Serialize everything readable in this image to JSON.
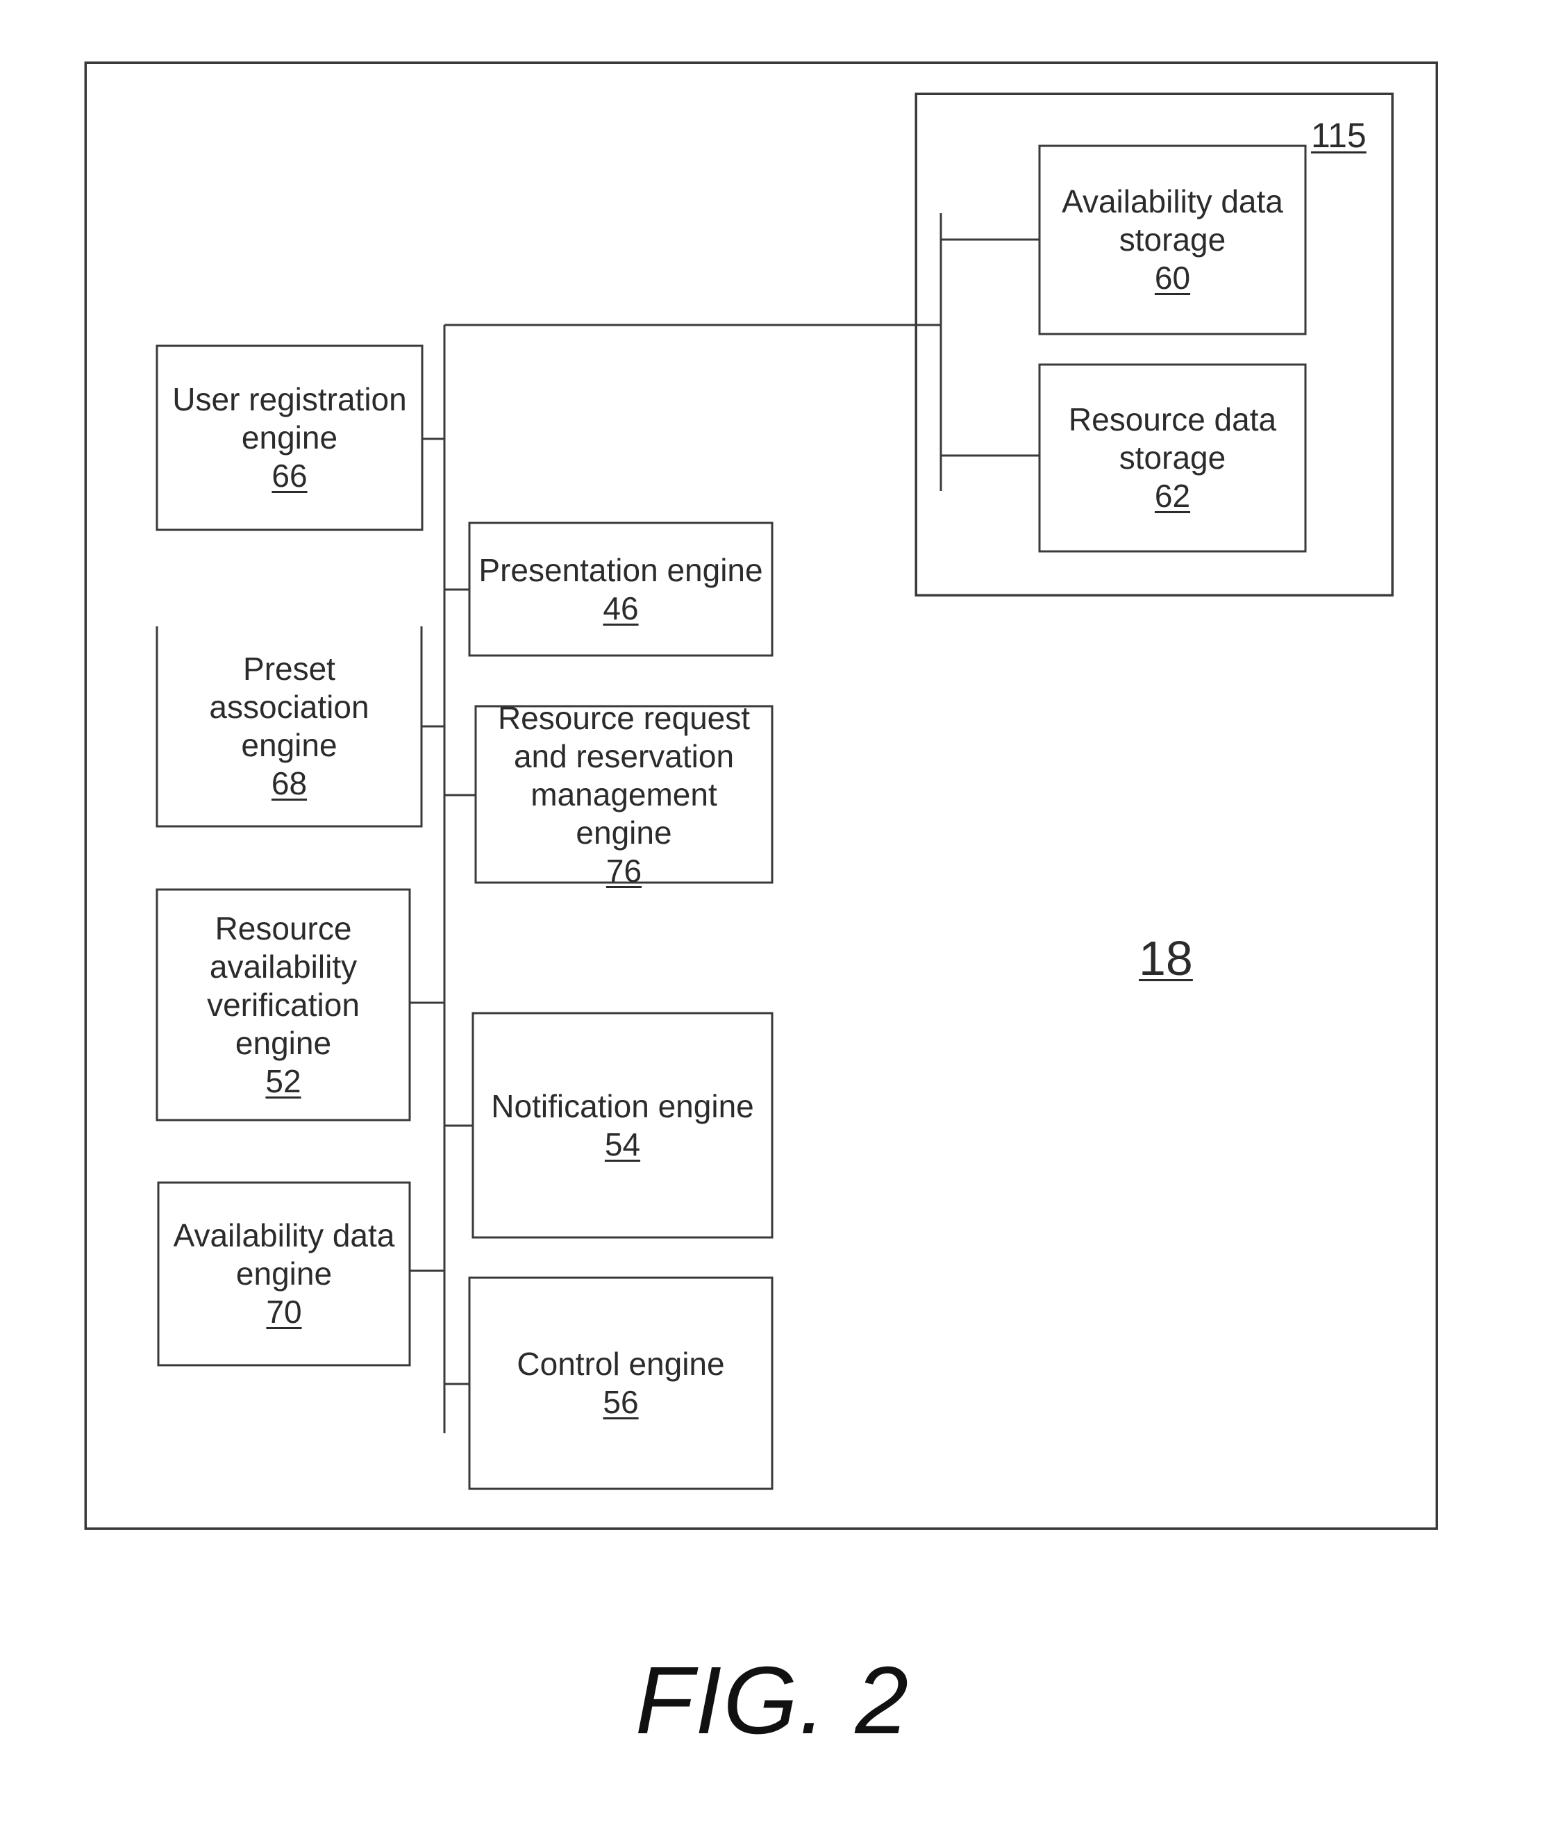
{
  "figure": {
    "caption": "FIG. 2",
    "system_ref": "18",
    "storage_group_ref": "115"
  },
  "engines_left": [
    {
      "name": "User registration\nengine",
      "ref": "66"
    },
    {
      "name": "Preset\nassociation\nengine",
      "ref": "68"
    },
    {
      "name": "Resource\navailability\nverification\nengine",
      "ref": "52"
    },
    {
      "name": "Availability data\nengine",
      "ref": "70"
    }
  ],
  "engines_center": [
    {
      "name": "Presentation engine",
      "ref": "46"
    },
    {
      "name": "Resource request\nand reservation\nmanagement\nengine",
      "ref": "76"
    },
    {
      "name": "Notification engine",
      "ref": "54"
    },
    {
      "name": "Control engine",
      "ref": "56"
    }
  ],
  "storage": [
    {
      "name": "Availability data\nstorage",
      "ref": "60"
    },
    {
      "name": "Resource data\nstorage",
      "ref": "62"
    }
  ]
}
